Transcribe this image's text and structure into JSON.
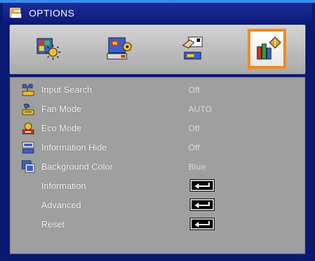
{
  "title": "OPTIONS",
  "tabs": [
    {
      "icon": "image-settings-icon",
      "active": false
    },
    {
      "icon": "screen-settings-icon",
      "active": false
    },
    {
      "icon": "setup-icon",
      "active": false
    },
    {
      "icon": "options-icon",
      "active": true
    }
  ],
  "colors": {
    "accent": "#f08a1a",
    "panel": "#9f9f9f",
    "frame": "#0a1a70"
  },
  "menu": [
    {
      "label": "Input Search",
      "value": "Off",
      "icon": "input-search-icon"
    },
    {
      "label": "Fan Mode",
      "value": "AUTO",
      "icon": "fan-mode-icon"
    },
    {
      "label": "Eco Mode",
      "value": "Off",
      "icon": "eco-mode-icon"
    },
    {
      "label": "Information Hide",
      "value": "Off",
      "icon": "information-hide-icon"
    },
    {
      "label": "Background Color",
      "value": "Blue",
      "icon": "background-color-icon"
    },
    {
      "label": "Information",
      "value": "",
      "icon": "enter-icon"
    },
    {
      "label": "Advanced",
      "value": "",
      "icon": "enter-icon"
    },
    {
      "label": "Reset",
      "value": "",
      "icon": "enter-icon"
    }
  ]
}
